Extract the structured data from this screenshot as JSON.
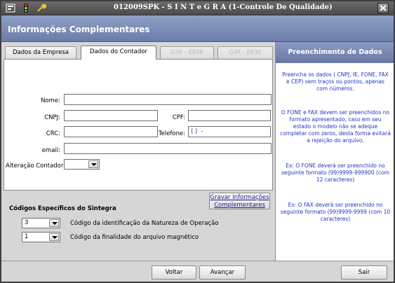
{
  "window": {
    "title": "012009SPK - S I N T e G R A (1-Controle De Qualidade)"
  },
  "header": {
    "title": "Informações Complementares"
  },
  "tabs": [
    {
      "label": "Dados da Empresa",
      "active": false,
      "disabled": false
    },
    {
      "label": "Dados do Contador",
      "active": true,
      "disabled": false
    },
    {
      "label": "GIM - 8806",
      "active": false,
      "disabled": true
    },
    {
      "label": "GIM - 8830",
      "active": false,
      "disabled": true
    }
  ],
  "form": {
    "nome_label": "Nome:",
    "nome_value": "",
    "cnpj_label": "CNPJ:",
    "cnpj_value": "",
    "cpf_label": "CPF:",
    "cpf_value": "",
    "crc_label": "CRC:",
    "crc_value": "",
    "telefone_label": "Telefone:",
    "telefone_value": "( )  -",
    "email_label": "email:",
    "email_value": "",
    "alteracao_label": "Alteração Contador:",
    "alteracao_value": ""
  },
  "gravar_button": "Gravar Informações Complementares",
  "section": {
    "title": "Códigos Específicos do Sintegra",
    "natureza_value": "3",
    "natureza_label": "Código da identificação da Natureza de Operação",
    "finalidade_value": "1",
    "finalidade_label": "Código da finalidade do arquivo magnético"
  },
  "right_panel": {
    "title": "Preenchimento de Dados",
    "notes": [
      "Preencha os dados ( CNPJ, IE, FONE, FAX e CEP) sem traços ou pontos, apenas com números.",
      "O FONE e FAX  devem ser preenchidos no formato apresentado, caso em seu estado o modelo não se adeque completar com zeros, desta forma evitará a rejeição do arquivo.",
      "Ex: O FONE deverá ser preenchido no seguinte formato (99)9999-999900 (com 12 caracteres)",
      "Ex: O FAX deverá ser preenchido no seguinte formato (99)9999-9999  (com 10 caracteres)"
    ]
  },
  "footer": {
    "voltar": "Voltar",
    "avancar": "Avançar",
    "sair": "Sair"
  },
  "colors": {
    "header": "#6b7ca8",
    "note_text": "#1f36c4",
    "titlebar": "#5a5a5a"
  }
}
